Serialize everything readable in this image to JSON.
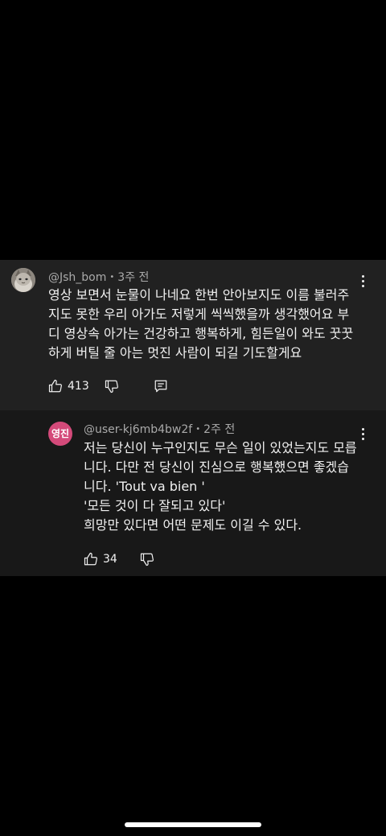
{
  "comment": {
    "author": "@Jsh_bom",
    "separator": "•",
    "time": "3주 전",
    "lines": [
      "영상 보면서 눈물이 나네요 한번 안아보지도 이름 불러주",
      "지도 못한 우리 아가도 저렇게 씩씩했을까 생각했어요 부",
      "디 영상속 아가는 건강하고 행복하게, 힘든일이 와도 꿋꿋",
      "하게 버틸 줄 아는 멋진 사람이 되길 기도할게요"
    ],
    "like_count": "413",
    "icons": {
      "avatar": "cat-avatar-image",
      "like": "thumbs-up-icon",
      "dislike": "thumbs-down-icon",
      "reply": "reply-comment-icon",
      "menu": "more-vert-icon"
    }
  },
  "reply": {
    "avatar_text": "영진",
    "author": "@user-kj6mb4bw2f",
    "separator": "•",
    "time": "2주 전",
    "lines": [
      "저는 당신이 누구인지도 무슨 일이 있었는지도 모릅",
      "니다. 다만 전 당신이 진심으로 행복했으면 좋겠습",
      "니다. 'Tout va bien '",
      "'모든 것이 다 잘되고 있다'",
      "희망만 있다면 어떤 문제도 이길 수 있다."
    ],
    "like_count": "34",
    "icons": {
      "like": "thumbs-up-icon",
      "dislike": "thumbs-down-icon",
      "menu": "more-vert-icon"
    }
  },
  "colors": {
    "background": "#000000",
    "comment_bg": "#212121",
    "reply_bg": "#181818",
    "avatar_accent": "#d44a7a",
    "text_primary": "#f1f1f1",
    "text_secondary": "#aaaaaa"
  }
}
